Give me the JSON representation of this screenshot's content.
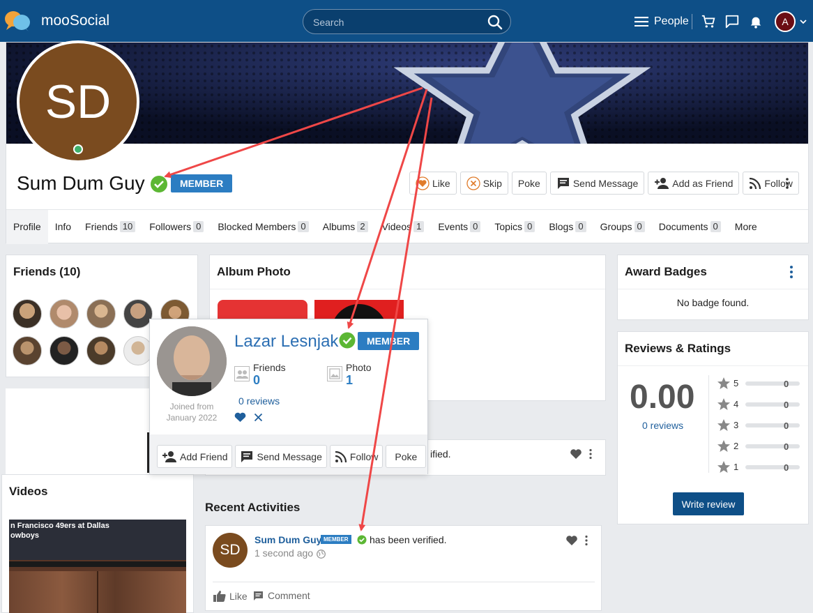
{
  "topbar": {
    "brand": "mooSocial",
    "search_placeholder": "Search",
    "people_label": "People",
    "avatar_initial": "A"
  },
  "profile": {
    "initials": "SD",
    "name": "Sum Dum Guy",
    "badge": "MEMBER",
    "actions": [
      {
        "label": "Like",
        "icon": "heart-icon"
      },
      {
        "label": "Skip",
        "icon": "x-circle-icon"
      },
      {
        "label": "Poke",
        "icon": ""
      },
      {
        "label": "Send Message",
        "icon": "message-icon"
      },
      {
        "label": "Add as Friend",
        "icon": "add-person-icon"
      },
      {
        "label": "Follow",
        "icon": "rss-icon"
      }
    ]
  },
  "tabs": [
    {
      "label": "Profile",
      "count": ""
    },
    {
      "label": "Info",
      "count": ""
    },
    {
      "label": "Friends",
      "count": "10"
    },
    {
      "label": "Followers",
      "count": "0"
    },
    {
      "label": "Blocked Members",
      "count": "0"
    },
    {
      "label": "Albums",
      "count": "2"
    },
    {
      "label": "Videos",
      "count": "1"
    },
    {
      "label": "Events",
      "count": "0"
    },
    {
      "label": "Topics",
      "count": "0"
    },
    {
      "label": "Blogs",
      "count": "0"
    },
    {
      "label": "Groups",
      "count": "0"
    },
    {
      "label": "Documents",
      "count": "0"
    },
    {
      "label": "More",
      "count": ""
    }
  ],
  "friends": {
    "title": "Friends (10)"
  },
  "album": {
    "title": "Album Photo"
  },
  "videos": {
    "title": "Videos",
    "thumb_text_1": "n Francisco 49ers at Dallas",
    "thumb_text_2": "owboys"
  },
  "hovercard": {
    "name": "Lazar Lesnjak",
    "badge": "MEMBER",
    "joined_label": "Joined from",
    "joined_date": "January 2022",
    "friends_label": "Friends",
    "friends_count": "0",
    "photo_label": "Photo",
    "photo_count": "1",
    "reviews": "0 reviews",
    "buttons": [
      "Add Friend",
      "Send Message",
      "Follow",
      "Poke"
    ]
  },
  "partial_post_text": "ified.",
  "recent": {
    "title": "Recent Activities",
    "initials": "SD",
    "user": "Sum Dum Guy",
    "badge": "MEMBER",
    "text": "has been verified.",
    "time": "1 second ago",
    "like": "Like",
    "comment": "Comment"
  },
  "award": {
    "title": "Award Badges",
    "empty": "No badge found."
  },
  "reviews": {
    "title": "Reviews & Ratings",
    "score": "0.00",
    "count_label": "0 reviews",
    "rows": [
      {
        "star": "5",
        "count": "0"
      },
      {
        "star": "4",
        "count": "0"
      },
      {
        "star": "3",
        "count": "0"
      },
      {
        "star": "2",
        "count": "0"
      },
      {
        "star": "1",
        "count": "0"
      }
    ],
    "write": "Write review"
  },
  "colors": {
    "topbar": "#0e4f87",
    "accent": "#2c7dc2",
    "verified": "#5cb734",
    "annotation": "#ef4747"
  }
}
